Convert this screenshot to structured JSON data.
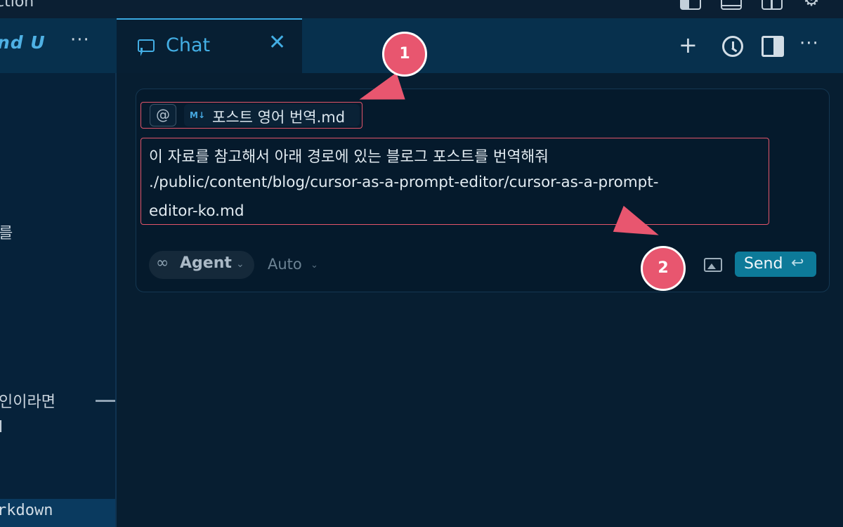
{
  "window": {
    "title_fragment": "ction"
  },
  "sidebar": {
    "title": "nd U",
    "more_label": "···",
    "text_fragments": [
      "를",
      "인이라면",
      "l"
    ],
    "bottom_label": "rkdown"
  },
  "chat_tab": {
    "label": "Chat",
    "close_label": "✕"
  },
  "toolbar": {
    "new_label": "+",
    "more_label": "···"
  },
  "context": {
    "at_label": "@",
    "file_icon_label": "M↓",
    "file_name": "포스트 영어 번역.md"
  },
  "message": {
    "lines": [
      " 이 자료를 참고해서 아래 경로에 있는 블로그 포스트를 번역해줘",
      "./public/content/blog/cursor-as-a-prompt-editor/cursor-as-a-prompt-",
      "editor-ko.md"
    ]
  },
  "composer": {
    "mode_icon": "∞",
    "mode_label": "Agent",
    "model_label": "Auto",
    "send_label": "Send",
    "send_key": "↩"
  },
  "annotations": {
    "callout_1": "1",
    "callout_2": "2",
    "accent_color": "#e8566f"
  }
}
